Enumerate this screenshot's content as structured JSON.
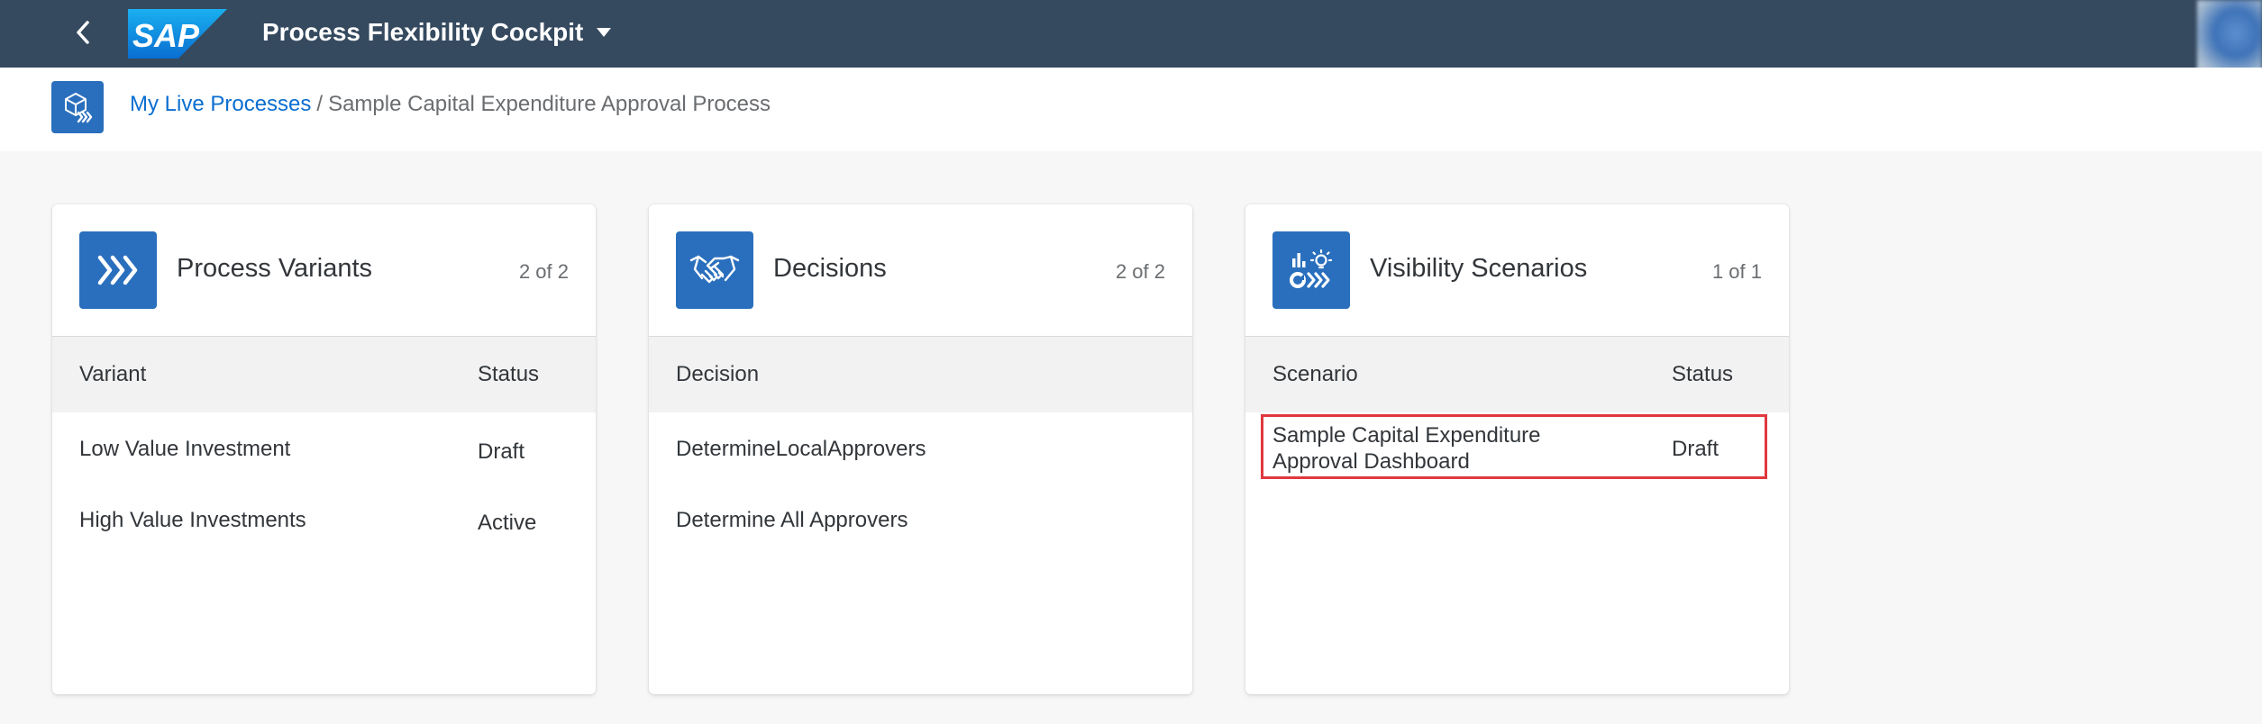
{
  "shell": {
    "logo_text": "SAP",
    "app_title": "Process Flexibility Cockpit",
    "back_icon": "chevron-left-icon",
    "title_menu_icon": "caret-down-icon"
  },
  "breadcrumb": {
    "link": "My Live Processes",
    "separator": "/",
    "current": "Sample Capital Expenditure Approval Process"
  },
  "colors": {
    "shell_bg": "#354a5f",
    "accent": "#2a6fbd",
    "link": "#0a6ed1",
    "highlight": "#e0383e"
  },
  "cards": {
    "variants": {
      "icon": "process-chevrons-icon",
      "title": "Process Variants",
      "count": "2 of 2",
      "col1": "Variant",
      "col2": "Status",
      "rows": [
        {
          "name": "Low Value Investment",
          "status": "Draft"
        },
        {
          "name": "High Value Investments",
          "status": "Active"
        }
      ]
    },
    "decisions": {
      "icon": "handshake-icon",
      "title": "Decisions",
      "count": "2 of 2",
      "col1": "Decision",
      "rows": [
        {
          "name": "DetermineLocalApprovers"
        },
        {
          "name": "Determine All Approvers"
        }
      ]
    },
    "visibility": {
      "icon": "visibility-scenario-icon",
      "title": "Visibility Scenarios",
      "count": "1 of 1",
      "col1": "Scenario",
      "col2": "Status",
      "rows": [
        {
          "name_line1": "Sample Capital Expenditure",
          "name_line2": "Approval Dashboard",
          "status": "Draft"
        }
      ]
    }
  }
}
